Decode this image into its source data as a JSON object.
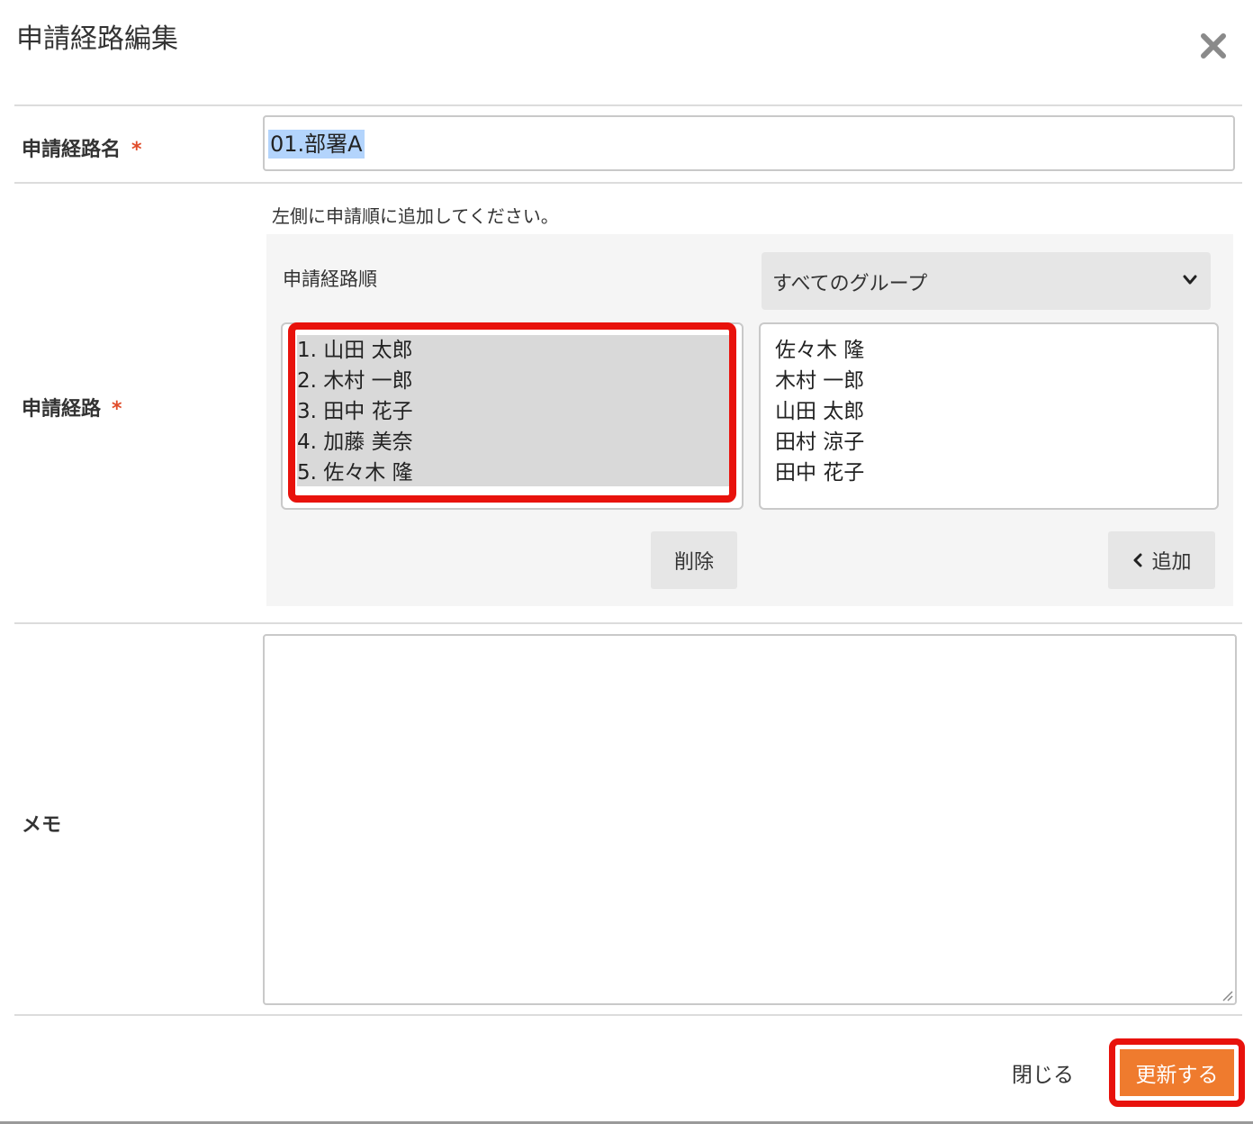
{
  "dialog": {
    "title": "申請経路編集",
    "close_icon": "close-icon"
  },
  "form": {
    "route_name": {
      "label": "申請経路名",
      "required_mark": "*",
      "value": "01.部署A"
    },
    "route": {
      "label": "申請経路",
      "required_mark": "*",
      "hint": "左側に申請順に追加してください。",
      "order_label": "申請経路順",
      "group_select": {
        "selected": "すべてのグループ",
        "icon": "chevron-down-icon"
      },
      "selected_list": [
        "1. 山田 太郎",
        "2. 木村 一郎",
        "3. 田中 花子",
        "4. 加藤 美奈",
        "5. 佐々木 隆"
      ],
      "available_list": [
        "佐々木 隆",
        "木村 一郎",
        "山田 太郎",
        "田村 涼子",
        "田中 花子"
      ],
      "delete_button": "削除",
      "add_button": "追加",
      "add_icon": "chevron-left-icon"
    },
    "memo": {
      "label": "メモ",
      "value": ""
    }
  },
  "footer": {
    "close_label": "閉じる",
    "update_label": "更新する"
  },
  "colors": {
    "required": "#e04c2a",
    "highlight": "#e8120c",
    "primary_button": "#ef7b2e",
    "selection": "#b3d4fc"
  }
}
